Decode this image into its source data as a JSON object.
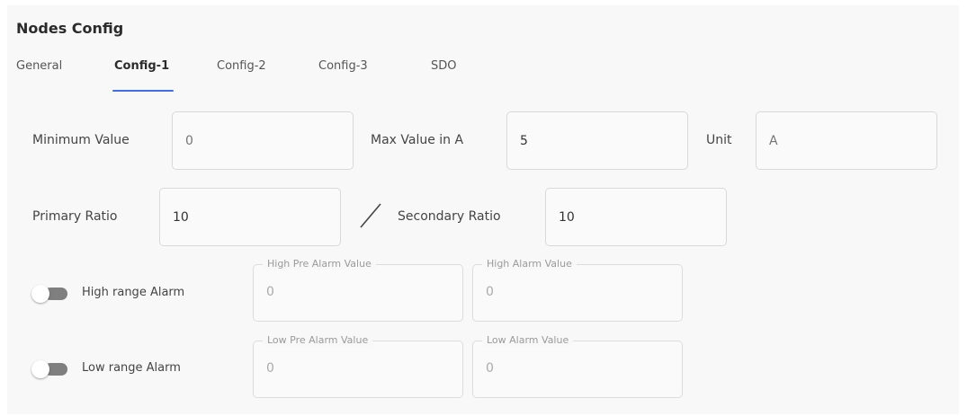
{
  "page": {
    "title": "Nodes Config"
  },
  "tabs": [
    {
      "label": "General",
      "active": false
    },
    {
      "label": "Config-1",
      "active": true
    },
    {
      "label": "Config-2",
      "active": false
    },
    {
      "label": "Config-3",
      "active": false
    },
    {
      "label": "SDO",
      "active": false
    }
  ],
  "accent_color": "#3d6ff0",
  "row1": {
    "min_label": "Minimum Value",
    "min_value": "",
    "min_placeholder": "0",
    "max_label": "Max Value in A",
    "max_value": "5",
    "unit_label": "Unit",
    "unit_value": "",
    "unit_placeholder": "A"
  },
  "row2": {
    "primary_label": "Primary Ratio",
    "primary_value": "10",
    "secondary_label": "Secondary Ratio",
    "secondary_value": "10"
  },
  "high_alarm": {
    "label": "High range Alarm",
    "enabled": false,
    "pre_legend": "High Pre Alarm Value",
    "pre_value": "0",
    "alarm_legend": "High Alarm Value",
    "alarm_value": "0"
  },
  "low_alarm": {
    "label": "Low range Alarm",
    "enabled": false,
    "pre_legend": "Low Pre Alarm Value",
    "pre_value": "0",
    "alarm_legend": "Low Alarm Value",
    "alarm_value": "0"
  }
}
